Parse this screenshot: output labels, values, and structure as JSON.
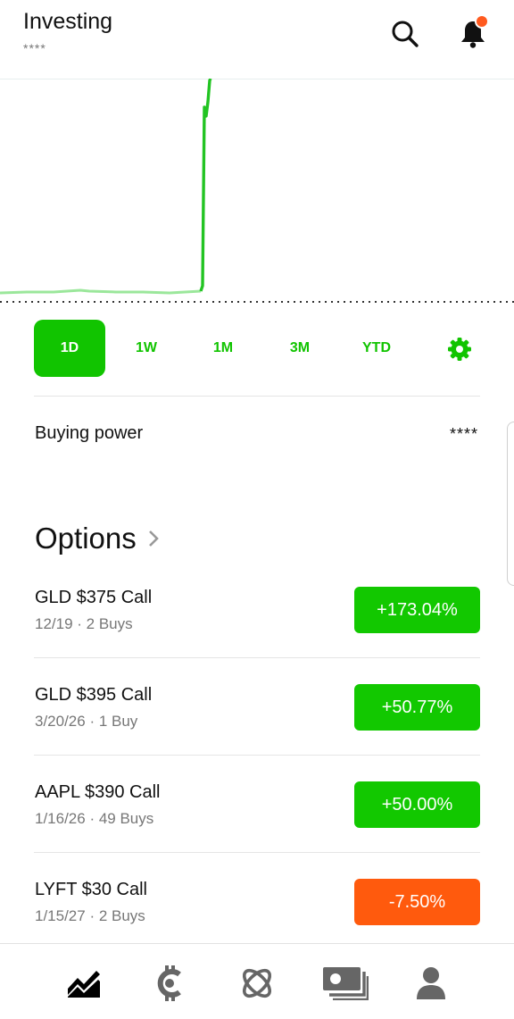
{
  "header": {
    "title": "Investing",
    "portfolio_value_masked": "****",
    "icons": {
      "search": "search-icon",
      "notifications": "bell-icon"
    },
    "notification_dot_color": "#ff5a1f"
  },
  "chart_data": {
    "type": "line",
    "color": "#22c422",
    "baseline_style": "dotted",
    "trend": "flat, then sharp rise at right of visible region"
  },
  "range_tabs": [
    {
      "label": "1D",
      "active": true
    },
    {
      "label": "1W",
      "active": false
    },
    {
      "label": "1M",
      "active": false
    },
    {
      "label": "3M",
      "active": false
    },
    {
      "label": "YTD",
      "active": false
    }
  ],
  "range_settings_icon": "gear-icon",
  "buying_power": {
    "label": "Buying power",
    "value": "****"
  },
  "options": {
    "title": "Options",
    "positions": [
      {
        "name": "GLD $375 Call",
        "detail": "12/19 · 2 Buys",
        "change": "+173.04%",
        "color": "#12c800"
      },
      {
        "name": "GLD $395 Call",
        "detail": "3/20/26 · 1 Buy",
        "change": "+50.77%",
        "color": "#12c800"
      },
      {
        "name": "AAPL $390 Call",
        "detail": "1/16/26 · 49 Buys",
        "change": "+50.00%",
        "color": "#12c800"
      },
      {
        "name": "LYFT $30 Call",
        "detail": "1/15/27 · 2 Buys",
        "change": "-7.50%",
        "color": "#ff5a0d"
      }
    ]
  },
  "bottom_nav": [
    {
      "icon": "chart-icon",
      "active": true
    },
    {
      "icon": "crypto-icon",
      "active": false
    },
    {
      "icon": "network-icon",
      "active": false
    },
    {
      "icon": "cash-icon",
      "active": false
    },
    {
      "icon": "account-icon",
      "active": false
    }
  ]
}
